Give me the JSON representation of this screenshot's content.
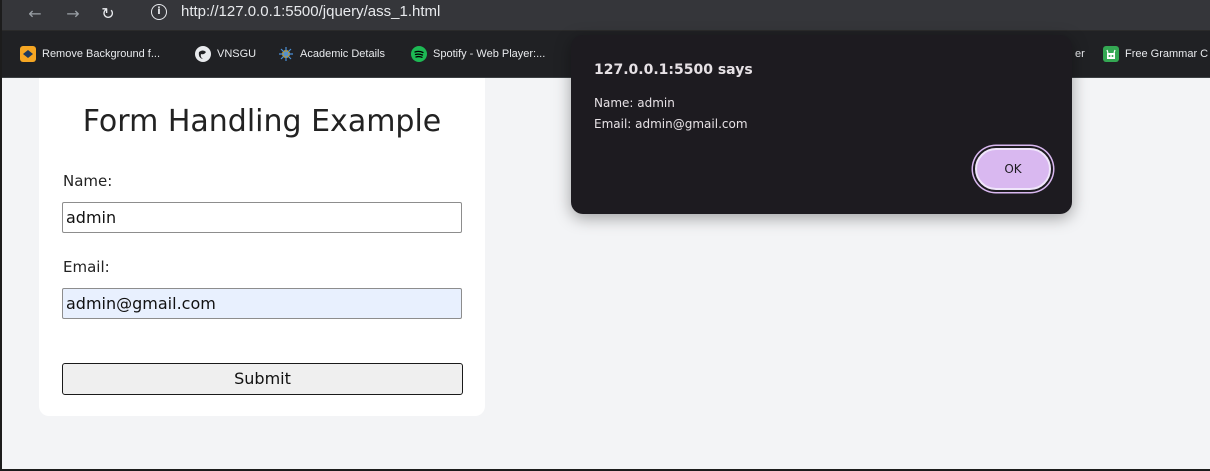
{
  "browser": {
    "url": "http://127.0.0.1:5500/jquery/ass_1.html",
    "nav": {
      "back": "←",
      "forward": "→",
      "reload": "↻"
    },
    "info_icon": "info-icon"
  },
  "bookmarks": [
    {
      "label": "Remove Background f...",
      "icon": "remove-bg-icon",
      "color": "#f5a623"
    },
    {
      "label": "VNSGU",
      "icon": "globe-icon",
      "color": "#e8eaed"
    },
    {
      "label": "Academic Details",
      "icon": "academic-icon",
      "color": "#4a90d9"
    },
    {
      "label": "Spotify - Web Player:...",
      "icon": "spotify-icon",
      "color": "#1db954"
    },
    {
      "label": "er",
      "icon": "",
      "color": ""
    },
    {
      "label": "Free Grammar C",
      "icon": "grammar-icon",
      "color": "#34a853"
    }
  ],
  "form": {
    "title": "Form Handling Example",
    "name_label": "Name:",
    "name_value": "admin",
    "email_label": "Email:",
    "email_value": "admin@gmail.com",
    "submit_label": "Submit"
  },
  "dialog": {
    "title": "127.0.0.1:5500 says",
    "line1": "Name: admin",
    "line2": "Email: admin@gmail.com",
    "ok_label": "OK"
  }
}
